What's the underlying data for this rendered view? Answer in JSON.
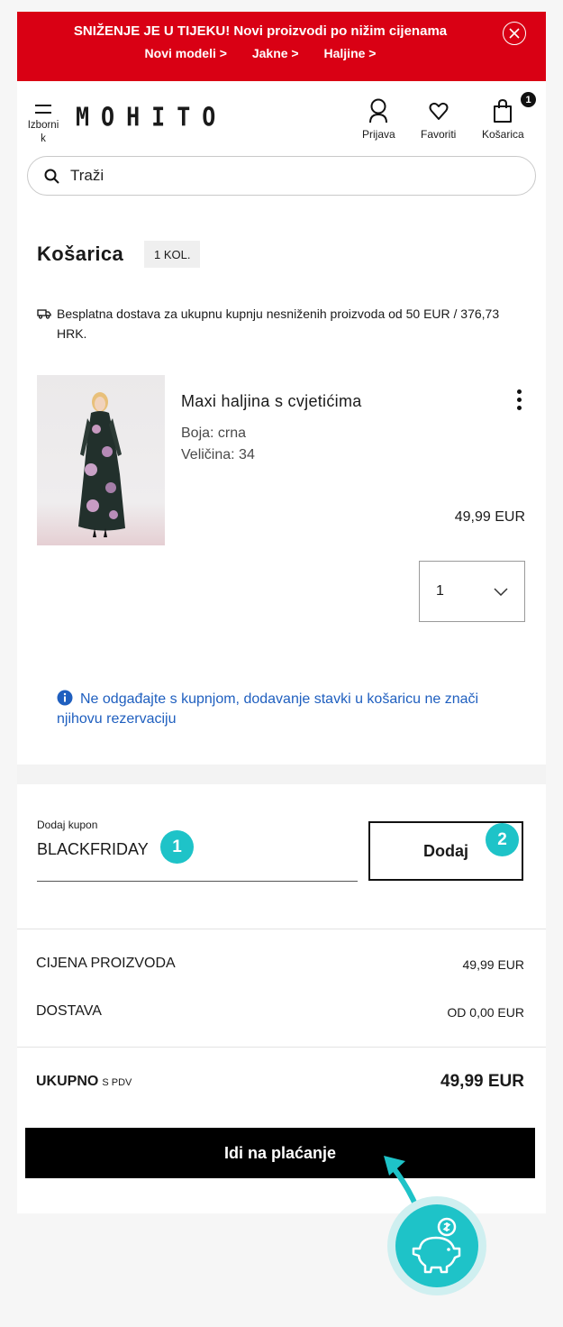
{
  "promo": {
    "title": "SNIŽENJE JE U TIJEKU! Novi proizvodi po nižim cijenama",
    "links": [
      "Novi modeli >",
      "Jakne >",
      "Haljine >"
    ]
  },
  "header": {
    "menu_label": "Izbornik",
    "logo": "MOHITO",
    "login_label": "Prijava",
    "favorites_label": "Favoriti",
    "cart_label": "Košarica",
    "cart_count": "1"
  },
  "search": {
    "placeholder": "Traži"
  },
  "cart": {
    "title": "Košarica",
    "quantity_badge": "1 KOL.",
    "shipping_note": "Besplatna dostava za ukupnu kupnju nesniženih proizvoda od 50 EUR / 376,73 HRK."
  },
  "product": {
    "name": "Maxi haljina s cvjetićima",
    "color": "Boja: crna",
    "size": "Veličina: 34",
    "price": "49,99 EUR",
    "quantity": "1"
  },
  "notice": "Ne odgađajte s kupnjom, dodavanje stavki u košaricu ne znači njihovu rezervaciju",
  "coupon": {
    "label": "Dodaj kupon",
    "value": "BLACKFRIDAY",
    "button": "Dodaj"
  },
  "steps": [
    "1",
    "2"
  ],
  "summary": {
    "products_label": "CIJENA PROIZVODA",
    "products_value": "49,99 EUR",
    "shipping_label": "DOSTAVA",
    "shipping_value": "OD 0,00 EUR",
    "total_label": "UKUPNO",
    "total_suffix": "S PDV",
    "total_value": "49,99 EUR"
  },
  "checkout_button": "Idi na plaćanje",
  "colors": {
    "promo_red": "#d90014",
    "accent_teal": "#1ec3c8",
    "notice_blue": "#1f5fbf"
  }
}
